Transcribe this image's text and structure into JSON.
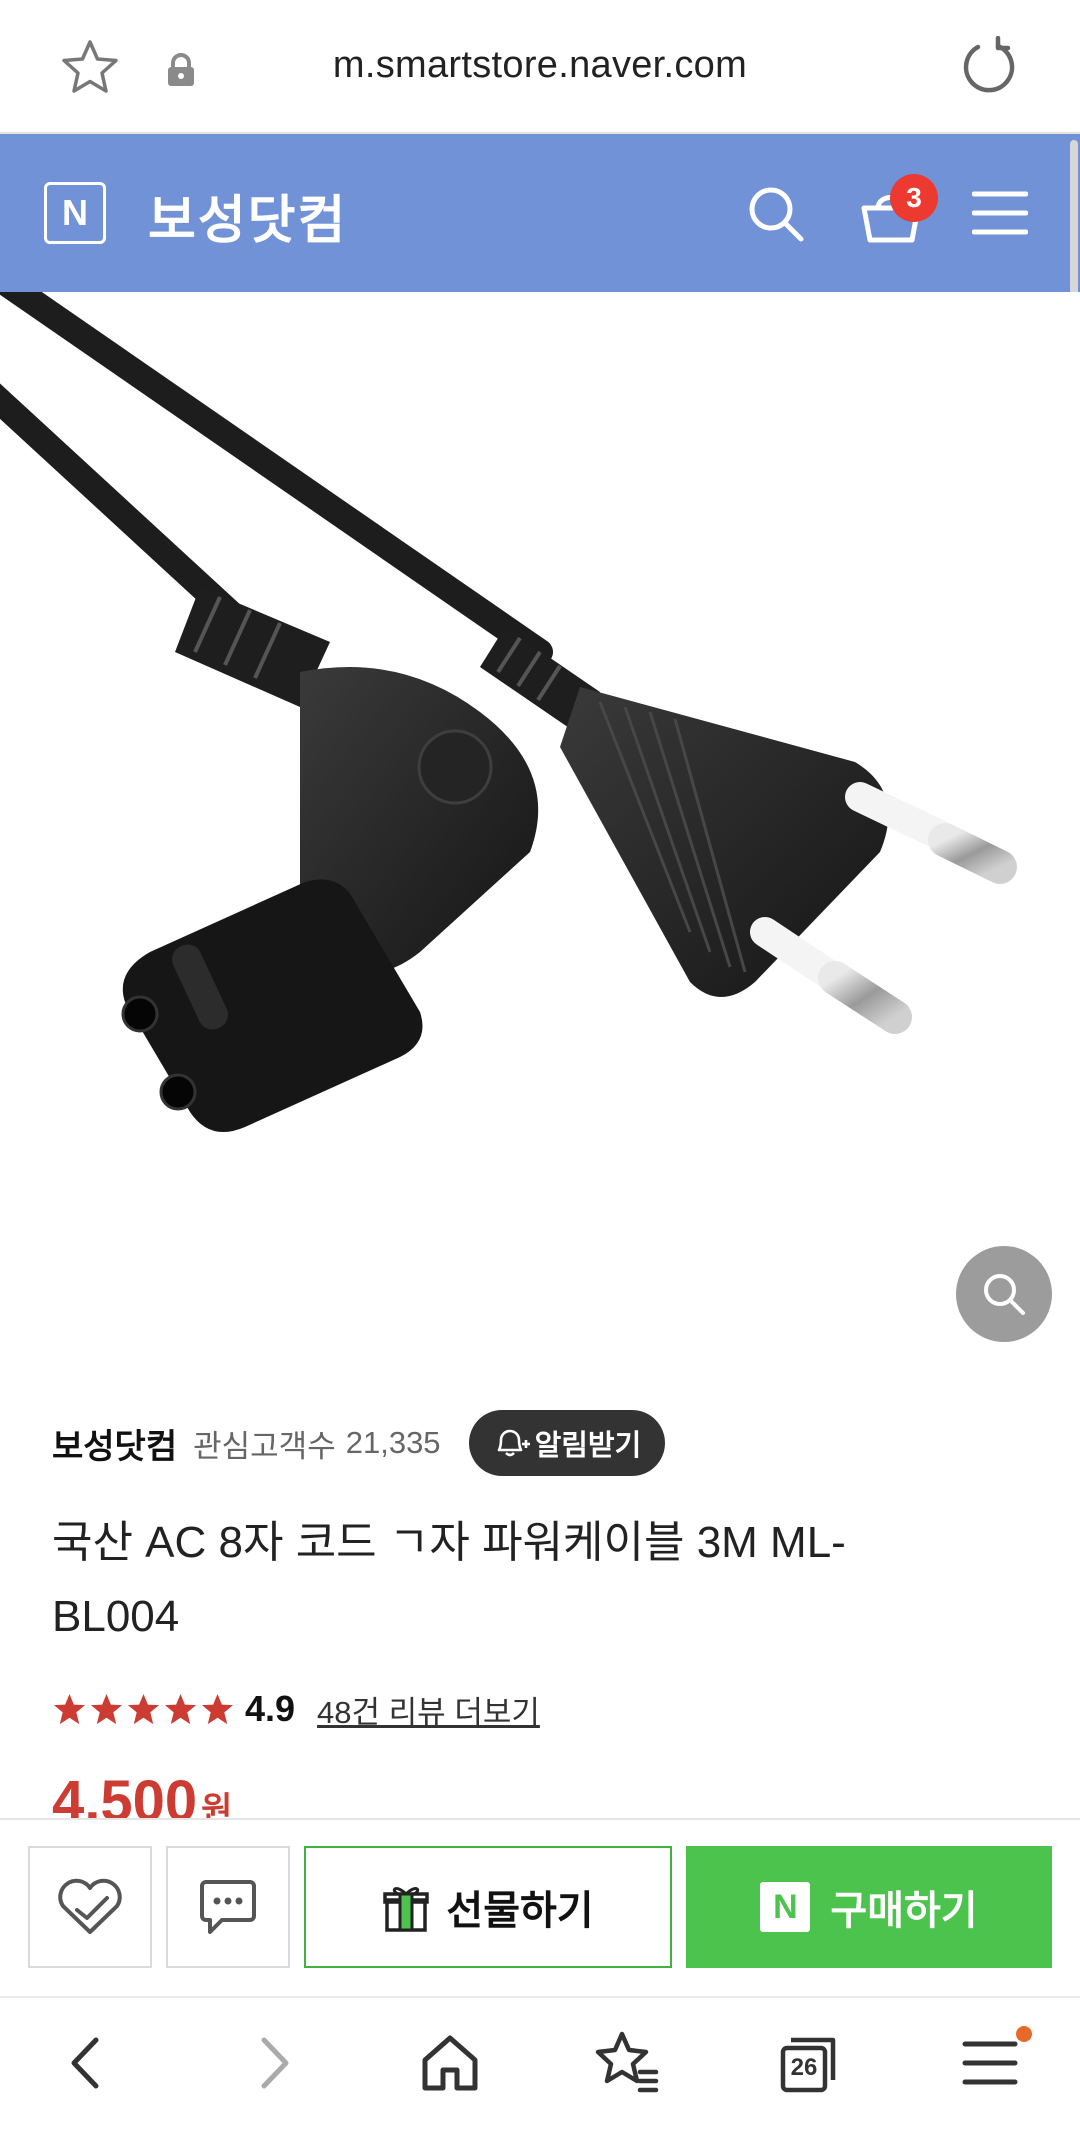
{
  "browser": {
    "url": "m.smartstore.naver.com",
    "tab_count": "26"
  },
  "header": {
    "logo_letter": "N",
    "store_name": "보성닷컴",
    "cart_count": "3",
    "accent_color": "#7192d6"
  },
  "product": {
    "seller_name": "보성닷컴",
    "follower_label": "관심고객수",
    "follower_count": "21,335",
    "notify_label": "알림받기",
    "title": "국산 AC 8자 코드 ㄱ자 파워케이블 3M ML-BL004",
    "rating": "4.9",
    "stars": 5,
    "review_link": "48건 리뷰 더보기",
    "price": "4,500",
    "price_unit": "원",
    "price_color": "#cc3c33"
  },
  "actions": {
    "gift_label": "선물하기",
    "buy_logo": "N",
    "buy_label": "구매하기",
    "buy_color": "#4cc34c"
  },
  "icons": {
    "url_bar": [
      "star-icon",
      "lock-icon",
      "reload-icon"
    ],
    "header": [
      "search-icon",
      "cart-icon",
      "menu-icon"
    ],
    "nav": [
      "back-icon",
      "forward-icon",
      "home-icon",
      "bookmarks-icon",
      "tabs-icon",
      "menu-icon"
    ]
  }
}
